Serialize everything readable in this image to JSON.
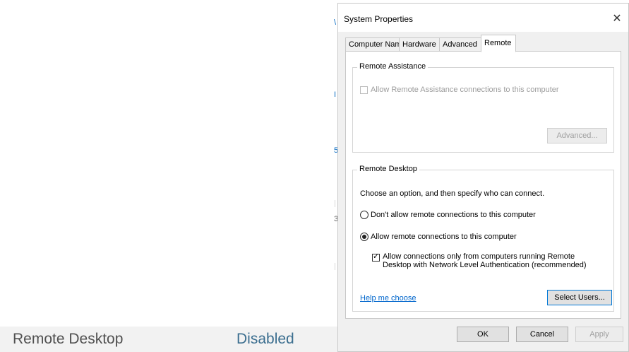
{
  "background": {
    "edge_glyphs": [
      "\\",
      "I",
      "5",
      "3"
    ],
    "bottom_row": {
      "label": "Remote Desktop",
      "value": "Disabled"
    }
  },
  "dialog": {
    "title": "System Properties",
    "close_glyph": "✕",
    "tabs": [
      {
        "label": "Computer Name"
      },
      {
        "label": "Hardware"
      },
      {
        "label": "Advanced"
      },
      {
        "label": "Remote"
      }
    ],
    "remote_assistance": {
      "group_title": "Remote Assistance",
      "allow_label": "Allow Remote Assistance connections to this computer",
      "advanced_button": "Advanced..."
    },
    "remote_desktop": {
      "group_title": "Remote Desktop",
      "intro": "Choose an option, and then specify who can connect.",
      "option_dont_allow": "Don't allow remote connections to this computer",
      "option_allow": "Allow remote connections to this computer",
      "nla_line1": "Allow connections only from computers running Remote",
      "nla_line2": "Desktop with Network Level Authentication (recommended)",
      "help_link": "Help me choose",
      "select_users_button": "Select Users..."
    },
    "footer": {
      "ok": "OK",
      "cancel": "Cancel",
      "apply": "Apply"
    }
  }
}
